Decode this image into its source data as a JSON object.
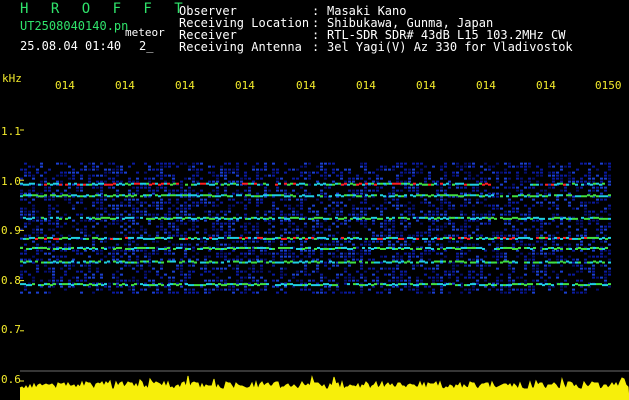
{
  "header": {
    "brand": "H R O F F T",
    "filename": "UT2508040140.pn",
    "tag": "meteor",
    "datetime": "25.08.04 01:40",
    "counter": "2_"
  },
  "info": [
    {
      "label": "Observer",
      "sep": ":",
      "value": "Masaki Kano"
    },
    {
      "label": "Receiving Location",
      "sep": ":",
      "value": "Shibukawa, Gunma, Japan"
    },
    {
      "label": "Receiver",
      "sep": ":",
      "value": "RTL-SDR SDR# 43dB L15 103.2MHz CW"
    },
    {
      "label": "Receiving Antenna",
      "sep": ":",
      "value": "3el Yagi(V) Az 330 for Vladivostok"
    }
  ],
  "y_axis": {
    "unit": "kHz",
    "ticks": [
      "1.1",
      "1.0",
      "0.9",
      "0.8",
      "0.7",
      "0.6"
    ]
  },
  "x_axis": {
    "ticks": [
      "014",
      "014",
      "014",
      "014",
      "014",
      "014",
      "014",
      "014",
      "014",
      "0150"
    ]
  },
  "colors": {
    "text_green": "#2fe36b",
    "text_white": "#ffffff",
    "label_yellow": "#f2ea2c",
    "noise_blue": "#0a1aa0",
    "signal_cyan": "#20d0e0",
    "signal_green": "#40e040",
    "signal_red": "#ff2020",
    "amplitude_yellow": "#f7ef0a"
  }
}
